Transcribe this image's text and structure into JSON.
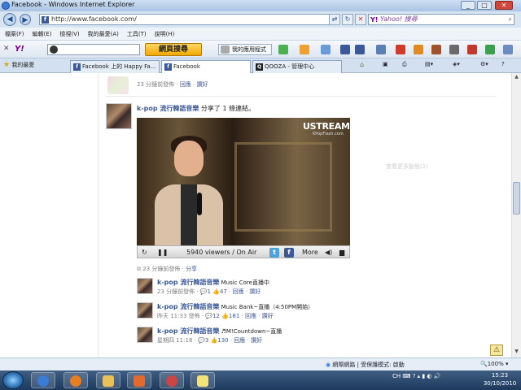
{
  "window": {
    "title": "Facebook - Windows Internet Explorer"
  },
  "address": {
    "url": "http://www.facebook.com/"
  },
  "search": {
    "placeholder": "Yahoo! 搜尋"
  },
  "menu": [
    "檔案(F)",
    "編輯(E)",
    "檢視(V)",
    "我的最愛(A)",
    "工具(T)",
    "說明(H)"
  ],
  "toolbar": {
    "web_search": "網頁搜尋",
    "my_apps": "我的應用程式"
  },
  "favorites": {
    "label": "我的最愛"
  },
  "tabs": [
    {
      "label": "Facebook 上的 Happy Fa..."
    },
    {
      "label": "Facebook"
    },
    {
      "label": "QOOZA - 管理中心"
    }
  ],
  "feed": {
    "top_meta": {
      "time": "23 分鐘前發佈",
      "reply": "回應",
      "more": "讚好"
    },
    "post": {
      "author": "k-pop 流行韓語音樂",
      "action_text": "分享了 1 條連結。",
      "video": {
        "brand": "USTREAM",
        "brand_sub": "KPopFlash.com",
        "viewers": "5940 viewers / On Air",
        "more": "More"
      },
      "meta": {
        "time": "23 分鐘前發佈",
        "share": "分享"
      }
    },
    "comments": [
      {
        "author": "k-pop 流行韓語音樂",
        "text": "Music Core直播中",
        "time": "23 分鐘前發佈",
        "comments": "1",
        "likes": "47",
        "reply": "回應",
        "like": "讚好"
      },
      {
        "author": "k-pop 流行韓語音樂",
        "text": "Music Bank~直播（4:50PM開始）",
        "time": "昨天 11:33 發佈",
        "comments": "12",
        "likes": "181",
        "reply": "回應",
        "like": "讚好"
      },
      {
        "author": "k-pop 流行韓語音樂",
        "text": "♬M!Countdown~直播",
        "time": "星期四 11:18",
        "comments": "3",
        "likes": "130",
        "reply": "回應",
        "like": "讚好"
      }
    ],
    "chat_placeholder": "查看更多動態(1)"
  },
  "status": {
    "security": "網際網路 | 受保護模式: 啟動",
    "zoom": "100%"
  },
  "taskbar": {
    "lang": "CH",
    "time": "15:23",
    "date": "30/10/2010"
  }
}
